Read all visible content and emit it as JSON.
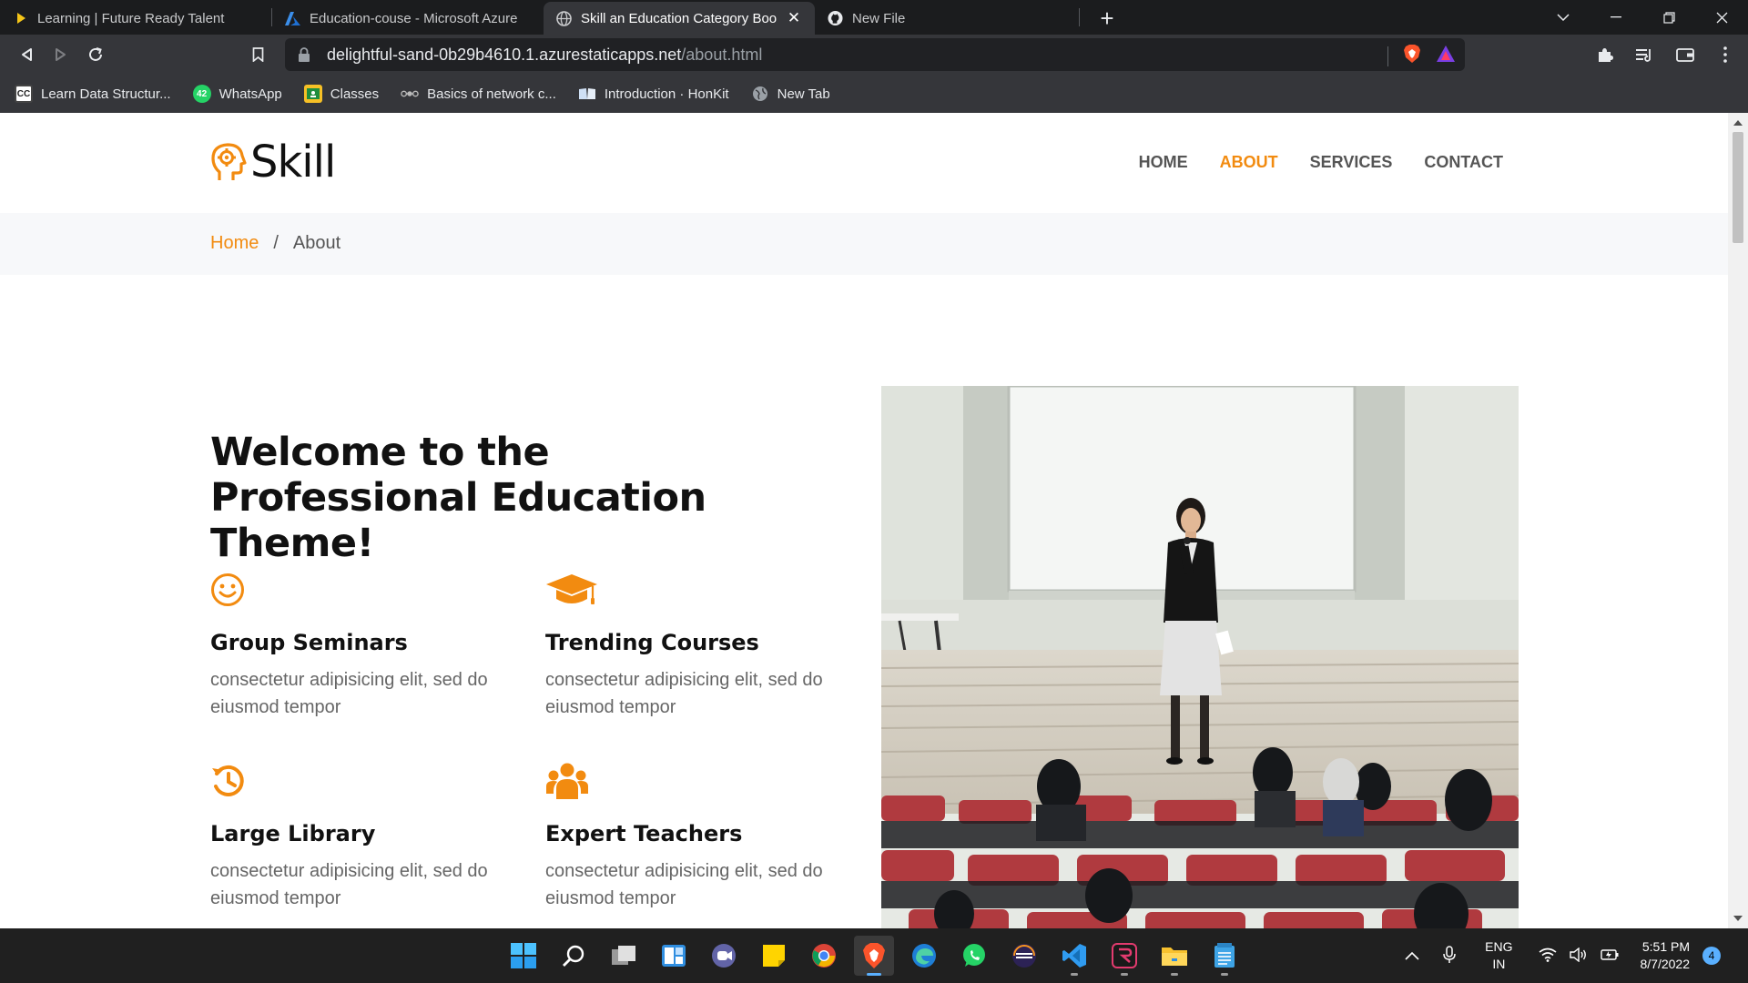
{
  "browser": {
    "tabs": [
      {
        "title": "Learning | Future Ready Talent",
        "icon": "play-icon",
        "active": false
      },
      {
        "title": "Education-couse - Microsoft Azure",
        "icon": "azure-icon",
        "active": false
      },
      {
        "title": "Skill an Education Category Boots",
        "icon": "globe-icon",
        "active": true
      },
      {
        "title": "New File",
        "icon": "github-icon",
        "active": false
      }
    ],
    "url_host": "delightful-sand-0b29b4610.1.azurestaticapps.net",
    "url_path": "/about.html",
    "bookmarks": [
      {
        "label": "Learn Data Structur...",
        "icon": "cc-icon"
      },
      {
        "label": "WhatsApp",
        "icon": "whatsapp-icon",
        "badge": "42"
      },
      {
        "label": "Classes",
        "icon": "classroom-icon"
      },
      {
        "label": "Basics of network c...",
        "icon": "network-icon"
      },
      {
        "label": "Introduction · HonKit",
        "icon": "book-icon"
      },
      {
        "label": "New Tab",
        "icon": "globe-icon"
      }
    ]
  },
  "site": {
    "logo_text": "Skill",
    "nav": [
      "HOME",
      "ABOUT",
      "SERVICES",
      "CONTACT"
    ],
    "active_nav": "ABOUT",
    "breadcrumb": {
      "home": "Home",
      "separator": "/",
      "current": "About"
    },
    "headline": "Welcome to the Professional Education Theme!",
    "features": [
      {
        "title": "Group Seminars",
        "text": "consectetur adipisicing elit, sed do eiusmod tempor",
        "icon": "smiley-icon"
      },
      {
        "title": "Trending Courses",
        "text": "consectetur adipisicing elit, sed do eiusmod tempor",
        "icon": "graduation-cap-icon"
      },
      {
        "title": "Large Library",
        "text": "consectetur adipisicing elit, sed do eiusmod tempor",
        "icon": "history-icon"
      },
      {
        "title": "Expert Teachers",
        "text": "consectetur adipisicing elit, sed do eiusmod tempor",
        "icon": "users-icon"
      }
    ],
    "accent_color": "#f28b10"
  },
  "taskbar": {
    "apps": [
      "start",
      "search",
      "task-view",
      "widgets",
      "teams",
      "sticky-notes",
      "chrome",
      "brave",
      "edge",
      "whatsapp",
      "eclipse",
      "vscode",
      "app",
      "file-explorer",
      "notepad"
    ],
    "lang_line1": "ENG",
    "lang_line2": "IN",
    "time": "5:51 PM",
    "date": "8/7/2022",
    "notifications": "4"
  }
}
